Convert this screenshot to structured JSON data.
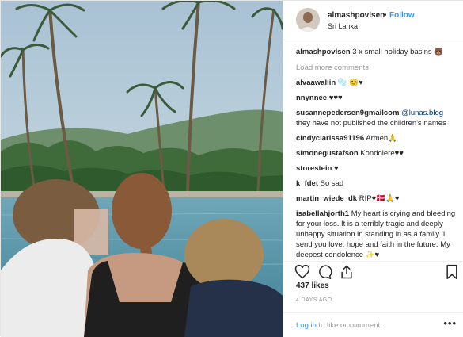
{
  "header": {
    "username": "almashpovlsen",
    "dot": "•",
    "follow_label": "Follow",
    "location": "Sri Lanka"
  },
  "caption": {
    "username": "almashpovlsen",
    "text": "3 x small holiday basins 🐻"
  },
  "load_more_label": "Load more comments",
  "comments": [
    {
      "username": "alvaawallin",
      "text": "🫧 😊♥"
    },
    {
      "username": "nnynnee",
      "text": "♥♥♥"
    },
    {
      "username": "susannepedersen9gmailcom",
      "mention": "@lunas.blog",
      "text": "they have not published the children's names"
    },
    {
      "username": "cindyclarissa91196",
      "text": "Armen🙏"
    },
    {
      "username": "simonegustafson",
      "text": "Kondolere♥♥"
    },
    {
      "username": "storestein",
      "text": "♥"
    },
    {
      "username": "k_fdet",
      "text": "So sad"
    },
    {
      "username": "martin_wiede_dk",
      "text": "RIP♥🇩🇰🙏♥"
    },
    {
      "username": "isabellahjorth1",
      "text": "My heart is crying and bleeding for your loss. It is a terribly tragic and deeply unhappy situation in standing in as a family. I send you love, hope and faith in the future. My deepest condolence ✨♥"
    }
  ],
  "likes": "437 likes",
  "timestamp": "4 DAYS AGO",
  "footer": {
    "login_link": "Log in",
    "login_rest": " to like or comment.",
    "more": "•••"
  },
  "icons": [
    "heart-icon",
    "comment-icon",
    "share-icon",
    "bookmark-icon"
  ]
}
